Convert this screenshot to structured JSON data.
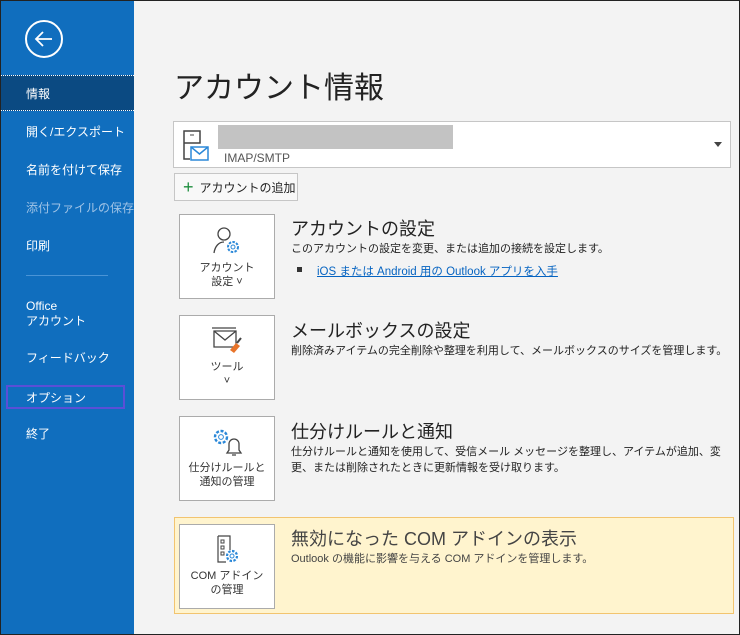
{
  "sidebar": {
    "items": [
      {
        "label": "情報"
      },
      {
        "label": "開く/エクスポート"
      },
      {
        "label": "名前を付けて保存"
      },
      {
        "label": "添付ファイルの保存"
      },
      {
        "label": "印刷"
      },
      {
        "label": "Office\nアカウント"
      },
      {
        "label": "フィードバック"
      },
      {
        "label": "オプション"
      },
      {
        "label": "終了"
      }
    ]
  },
  "main": {
    "title": "アカウント情報",
    "account": {
      "type": "IMAP/SMTP"
    },
    "add_account": "アカウントの追加",
    "sections": [
      {
        "button": "アカウント\n設定 ˅",
        "title": "アカウントの設定",
        "desc": "このアカウントの設定を変更、または追加の接続を設定します。",
        "link": "iOS または Android 用の Outlook アプリを入手"
      },
      {
        "button": "ツール\n˅",
        "title": "メールボックスの設定",
        "desc": "削除済みアイテムの完全削除や整理を利用して、メールボックスのサイズを管理します。"
      },
      {
        "button": "仕分けルールと\n通知の管理",
        "title": "仕分けルールと通知",
        "desc": "仕分けルールと通知を使用して、受信メール メッセージを整理し、アイテムが追加、変更、または削除されたときに更新情報を受け取ります。"
      },
      {
        "button": "COM アドイン\nの管理",
        "title": "無効になった COM アドインの表示",
        "desc": "Outlook の機能に影響を与える COM アドインを管理します。"
      }
    ]
  },
  "colors": {
    "sidebar": "#106ebe",
    "selected": "#0b4a82",
    "highlight": "#fff4ce"
  }
}
